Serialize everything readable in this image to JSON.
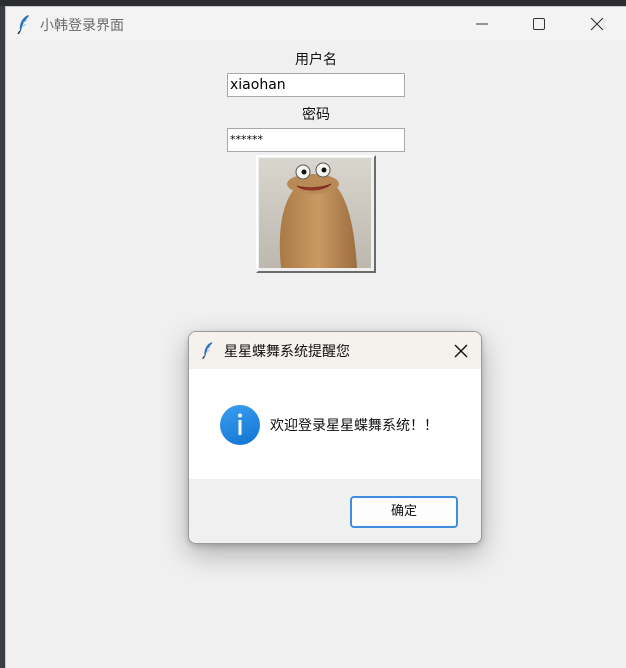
{
  "main_window": {
    "title": "小韩登录界面",
    "icons": {
      "app": "feather-icon",
      "minimize": "minimize-icon",
      "maximize": "maximize-icon",
      "close": "close-icon"
    }
  },
  "form": {
    "username_label": "用户名",
    "username_value": "xiaohan",
    "password_label": "密码",
    "password_value": "******",
    "image_button_icon": "frog-meme-image"
  },
  "dialog": {
    "title": "星星蝶舞系统提醒您",
    "message": "欢迎登录星星蝶舞系统！！",
    "ok_label": "确定",
    "icons": {
      "app": "feather-icon",
      "info": "info-icon",
      "close": "close-icon"
    }
  },
  "colors": {
    "accent": "#3f8ee0",
    "info_blue": "#1a7fdc",
    "window_bg": "#f0f0f0"
  }
}
